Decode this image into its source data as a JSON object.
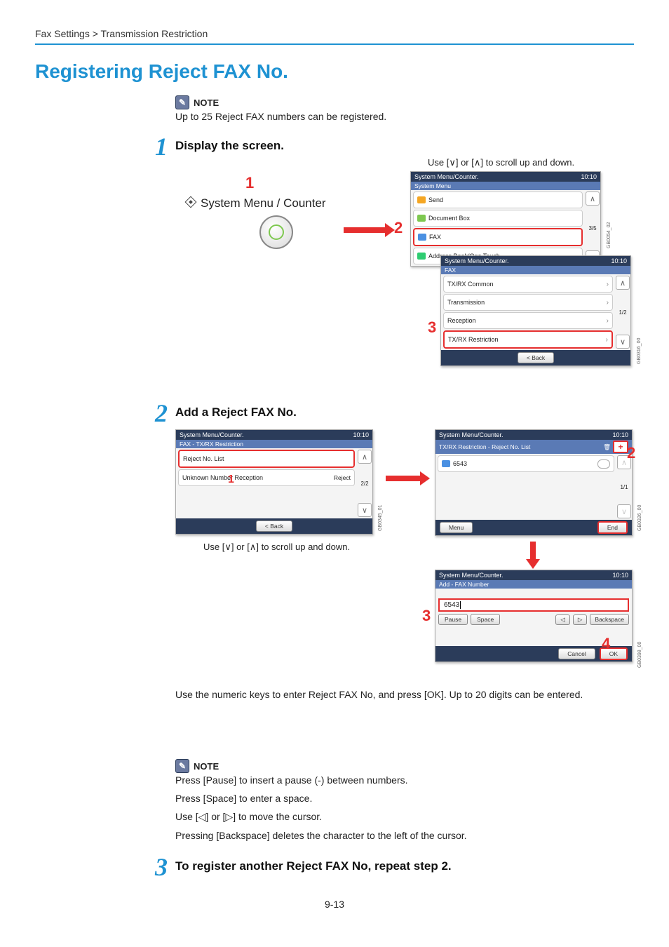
{
  "breadcrumb": "Fax Settings > Transmission Restriction",
  "page_title": "Registering Reject FAX No.",
  "note_label": "NOTE",
  "top_note": "Up to 25 Reject FAX numbers can be registered.",
  "steps": {
    "s1": {
      "num": "1",
      "title": "Display the screen."
    },
    "s2": {
      "num": "2",
      "title": "Add a Reject FAX No."
    },
    "s3": {
      "num": "3",
      "title": "To register another Reject FAX No, repeat step 2."
    }
  },
  "step1": {
    "scroll_hint": "Use [∨] or [∧] to scroll up and down.",
    "sysmenu_label": "System Menu / Counter",
    "callouts": {
      "c1": "1",
      "c2": "2",
      "c3": "3"
    },
    "panel_a": {
      "title": "System Menu/Counter.",
      "time": "10:10",
      "sub": "System Menu",
      "items": [
        "Send",
        "Document Box",
        "FAX",
        "Address Book/One Touch"
      ],
      "page": "3/5",
      "ref": "GB0054_02"
    },
    "panel_b": {
      "title": "System Menu/Counter.",
      "time": "10:10",
      "sub": "FAX",
      "items": [
        "TX/RX Common",
        "Transmission",
        "Reception",
        "TX/RX Restriction"
      ],
      "page": "1/2",
      "back": "< Back",
      "ref": "GB0316_00"
    }
  },
  "step2": {
    "callouts": {
      "c1": "1",
      "c2": "2",
      "c3": "3",
      "c4": "4"
    },
    "panel_a": {
      "title": "System Menu/Counter.",
      "time": "10:10",
      "sub": "FAX - TX/RX Restriction",
      "items": [
        "Reject No. List",
        "Unknown Number Reception"
      ],
      "reject_val": "Reject",
      "page": "2/2",
      "back": "< Back",
      "ref": "GB0345_01"
    },
    "scroll_hint_a": "Use [∨] or [∧] to scroll up and down.",
    "panel_b": {
      "title": "System Menu/Counter.",
      "time": "10:10",
      "sub": "TX/RX Restriction - Reject No. List",
      "entry": "6543",
      "page": "1/1",
      "menu": "Menu",
      "end": "End",
      "ref": "GB0326_00"
    },
    "panel_c": {
      "title": "System Menu/Counter.",
      "time": "10:10",
      "sub": "Add - FAX Number",
      "value": "6543",
      "pause": "Pause",
      "space": "Space",
      "bksp": "Backspace",
      "cancel": "Cancel",
      "ok": "OK",
      "ref": "GB0398_00"
    },
    "after_text": "Use the numeric keys to enter Reject FAX No, and press [OK]. Up to 20 digits can be entered.",
    "note_lines": [
      "Press [Pause] to insert a pause (-) between numbers.",
      "Press [Space] to enter a space.",
      "Use [◁] or [▷] to move the cursor.",
      "Pressing [Backspace] deletes the character to the left of the cursor."
    ]
  },
  "footer": "9-13"
}
